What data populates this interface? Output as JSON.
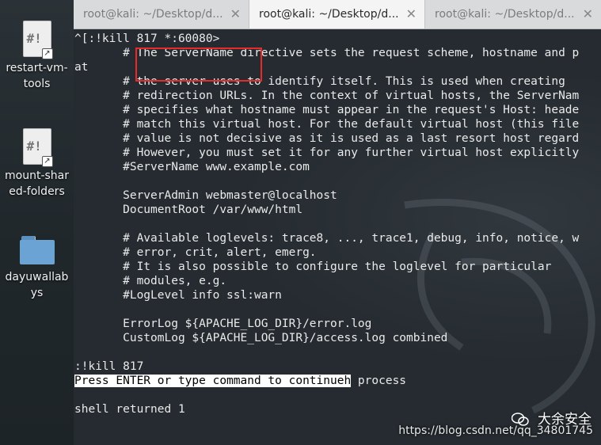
{
  "desktop": {
    "icons": [
      {
        "label": "restart-vm-tools",
        "kind": "script"
      },
      {
        "label": "mount-shared-folders",
        "kind": "script"
      },
      {
        "label": "dayuwallabys",
        "kind": "folder"
      }
    ]
  },
  "tabs": [
    {
      "title": "root@kali: ~/Desktop/d...",
      "close": "✕"
    },
    {
      "title": "root@kali: ~/Desktop/d...",
      "close": "✕"
    },
    {
      "title": "root@kali: ~/Desktop/d...",
      "close": "✕"
    }
  ],
  "terminal": {
    "lines": [
      "^[:!kill 817 *:60080>",
      "       # The ServerName directive sets the request scheme, hostname and p",
      "at",
      "       # the server uses to identify itself. This is used when creating",
      "       # redirection URLs. In the context of virtual hosts, the ServerNam",
      "       # specifies what hostname must appear in the request's Host: heade",
      "       # match this virtual host. For the default virtual host (this file",
      "       # value is not decisive as it is used as a last resort host regard",
      "       # However, you must set it for any further virtual host explicitly",
      "       #ServerName www.example.com",
      "",
      "       ServerAdmin webmaster@localhost",
      "       DocumentRoot /var/www/html",
      "",
      "       # Available loglevels: trace8, ..., trace1, debug, info, notice, w",
      "       # error, crit, alert, emerg.",
      "       # It is also possible to configure the loglevel for particular",
      "       # modules, e.g.",
      "       #LogLevel info ssl:warn",
      "",
      "       ErrorLog ${APACHE_LOG_DIR}/error.log",
      "       CustomLog ${APACHE_LOG_DIR}/access.log combined",
      "",
      ":!kill 817"
    ],
    "prompt_highlight": "Press ENTER or type command to continueh",
    "prompt_rest": " process",
    "after_prompt": [
      "",
      "shell returned 1"
    ]
  },
  "watermark": {
    "wechat_name": "大余安全",
    "url": "https://blog.csdn.net/qq_34801745"
  },
  "colors": {
    "terminal_bg": "#252b30",
    "terminal_fg": "#eaeaea",
    "annotation": "#e62b2b"
  }
}
